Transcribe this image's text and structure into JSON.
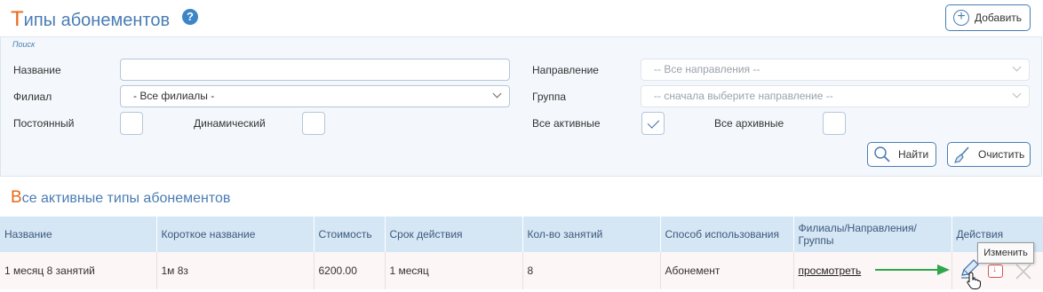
{
  "header": {
    "title_first": "Т",
    "title_rest": "ипы абонементов",
    "help_icon": "?",
    "add_label": "Добавить"
  },
  "filter": {
    "legend": "Поиск",
    "name_label": "Название",
    "name_value": "",
    "branch_label": "Филиал",
    "branch_value": "- Все филиалы -",
    "permanent_label": "Постоянный",
    "dynamic_label": "Динамический",
    "direction_label": "Направление",
    "direction_value": "-- Все направления --",
    "group_label": "Группа",
    "group_value": "-- сначала выберите направление --",
    "all_active_label": "Все активные",
    "all_archived_label": "Все архивные",
    "permanent_checked": false,
    "dynamic_checked": false,
    "all_active_checked": true,
    "all_archived_checked": false,
    "find_label": "Найти",
    "clear_label": "Очистить"
  },
  "section": {
    "title_first": "В",
    "title_rest": "се активные типы абонементов"
  },
  "table": {
    "headers": [
      "Название",
      "Короткое название",
      "Стоимость",
      "Срок действия",
      "Кол-во занятий",
      "Способ использования",
      "Филиалы/Направления/Группы",
      "Действия"
    ],
    "rows": [
      {
        "name": "1 месяц 8 занятий",
        "short_name": "1м 8з",
        "price": "6200.00",
        "duration": "1 месяц",
        "lessons": "8",
        "usage": "Абонемент",
        "branches_link": "просмотреть"
      }
    ]
  },
  "tooltip": "Изменить",
  "colors": {
    "accent": "#4a7db4",
    "title_first_letter": "#e8691a",
    "header_row": "#d5e6f5",
    "row_bg": "#fdf6f6",
    "arrow": "#2ea84a",
    "delete": "#d9534f"
  }
}
